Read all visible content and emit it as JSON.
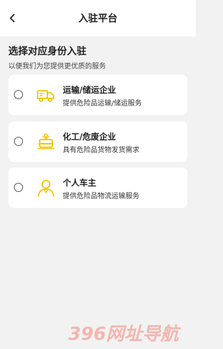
{
  "header": {
    "title": "入驻平台"
  },
  "intro": {
    "heading": "选择对应身份入驻",
    "subheading": "以便我们为您提供更优质的服务"
  },
  "options": [
    {
      "title": "运输/储运企业",
      "description": "提供危险品运输/储运服务",
      "icon": "truck-icon",
      "selected": false
    },
    {
      "title": "化工/危废企业",
      "description": "具有危险品货物发货需求",
      "icon": "factory-icon",
      "selected": false
    },
    {
      "title": "个人车主",
      "description": "提供危险品物流运输服务",
      "icon": "person-icon",
      "selected": false
    }
  ],
  "colors": {
    "accent": "#f5c400",
    "background": "#f2f2f2",
    "card": "#ffffff"
  },
  "watermark": {
    "text": "396网址导航"
  }
}
